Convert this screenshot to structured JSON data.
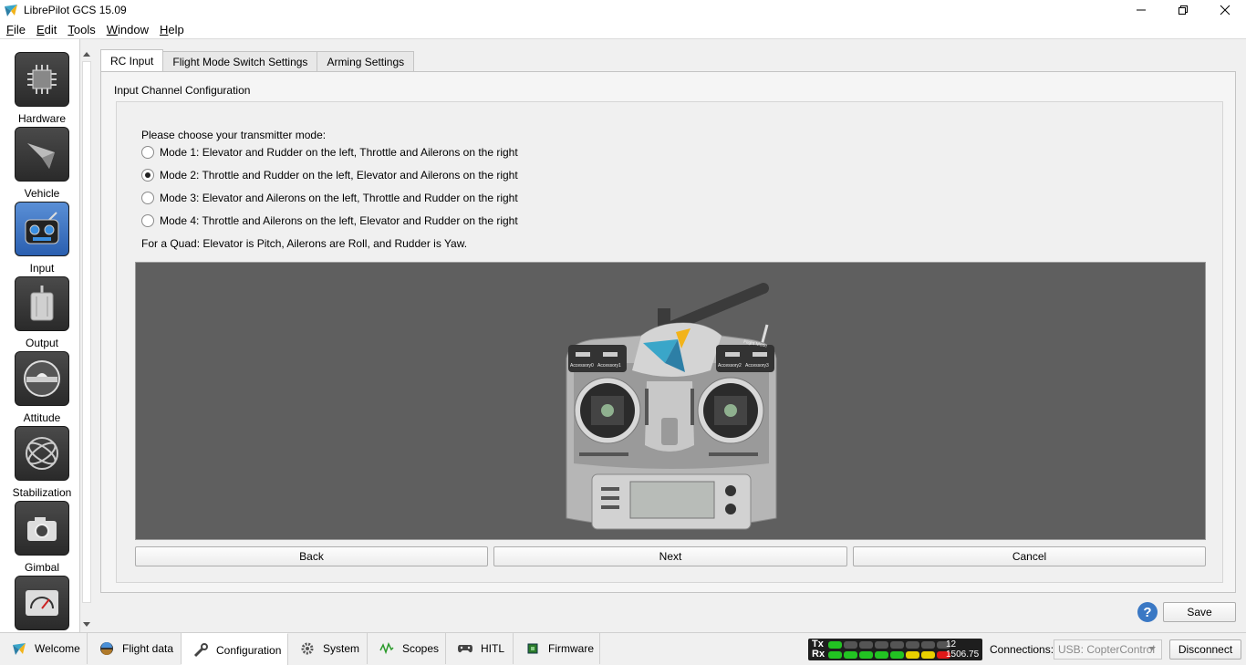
{
  "window": {
    "title": "LibrePilot GCS 15.09"
  },
  "menu": [
    {
      "label": "File",
      "ul": "F",
      "rest": "ile"
    },
    {
      "label": "Edit",
      "ul": "E",
      "rest": "dit"
    },
    {
      "label": "Tools",
      "ul": "T",
      "rest": "ools"
    },
    {
      "label": "Window",
      "ul": "W",
      "rest": "indow"
    },
    {
      "label": "Help",
      "ul": "H",
      "rest": "elp"
    }
  ],
  "sidebar": {
    "items": [
      {
        "label": "Hardware",
        "icon": "chip-icon"
      },
      {
        "label": "Vehicle",
        "icon": "plane-icon"
      },
      {
        "label": "Input",
        "icon": "transmitter-icon",
        "active": true
      },
      {
        "label": "Output",
        "icon": "motor-icon"
      },
      {
        "label": "Attitude",
        "icon": "level-icon"
      },
      {
        "label": "Stabilization",
        "icon": "gyro-icon"
      },
      {
        "label": "Gimbal",
        "icon": "camera-icon"
      },
      {
        "label": "",
        "icon": "meter-icon"
      }
    ]
  },
  "tabs": [
    {
      "label": "RC Input",
      "active": true
    },
    {
      "label": "Flight Mode Switch Settings"
    },
    {
      "label": "Arming Settings"
    }
  ],
  "panel": {
    "section_title": "Input Channel Configuration",
    "prompt": "Please choose your transmitter mode:",
    "modes": [
      {
        "label": "Mode 1: Elevator and Rudder on the left, Throttle and Ailerons on the right",
        "checked": false
      },
      {
        "label": "Mode 2: Throttle and Rudder on the left, Elevator and Ailerons on the right",
        "checked": true
      },
      {
        "label": "Mode 3: Elevator and Ailerons on the left, Throttle and Rudder on the right",
        "checked": false
      },
      {
        "label": "Mode 4: Throttle and Ailerons on the left, Elevator and Rudder on the right",
        "checked": false
      }
    ],
    "note": "For a Quad: Elevator is Pitch, Ailerons are Roll, and Rudder is Yaw.",
    "transmitter_labels": {
      "acc0": "Accessory0",
      "acc1": "Accessory1",
      "acc2": "Accessory2",
      "acc3": "Accessory3",
      "flight_mode": "Flight Mode"
    },
    "buttons": {
      "back": "Back",
      "next": "Next",
      "cancel": "Cancel"
    }
  },
  "save_label": "Save",
  "help_glyph": "?",
  "bottom_tabs": [
    {
      "label": "Welcome",
      "icon": "welcome-icon"
    },
    {
      "label": "Flight data",
      "icon": "flight-data-icon"
    },
    {
      "label": "Configuration",
      "icon": "wrench-icon",
      "active": true
    },
    {
      "label": "System",
      "icon": "gears-icon"
    },
    {
      "label": "Scopes",
      "icon": "scope-icon"
    },
    {
      "label": "HITL",
      "icon": "gamepad-icon"
    },
    {
      "label": "Firmware",
      "icon": "firmware-icon"
    }
  ],
  "telemetry": {
    "tx_label": "Tx",
    "rx_label": "Rx",
    "tx_value": "12",
    "rx_value": "1506.75",
    "tx_leds_on": 1,
    "rx_leds": [
      "green",
      "green",
      "green",
      "green",
      "green",
      "yellow",
      "yellow",
      "red"
    ],
    "colors": {
      "green": "#22c322",
      "yellow": "#e8d000",
      "red": "#e01818",
      "off": "#555555"
    }
  },
  "connections": {
    "label": "Connections:",
    "selected": "USB: CopterControl",
    "disconnect": "Disconnect"
  }
}
